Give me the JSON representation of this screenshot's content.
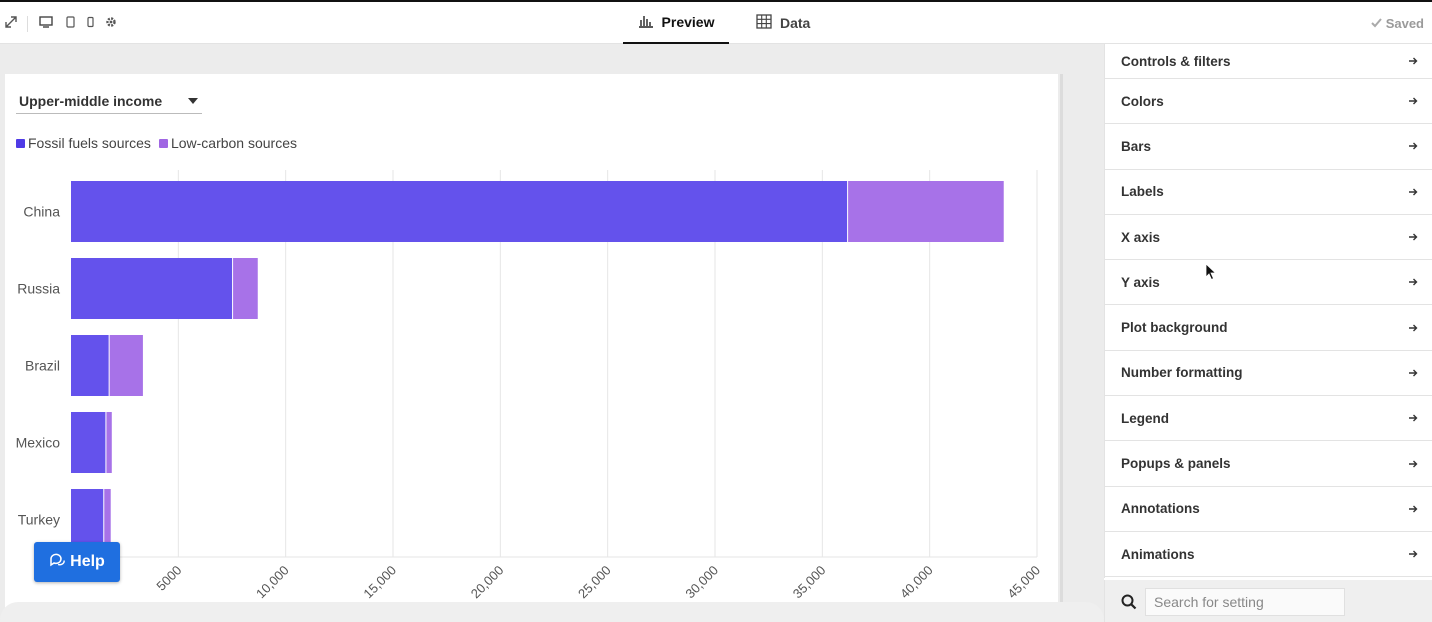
{
  "toolbar": {
    "tabs": [
      {
        "label": "Preview",
        "icon": "bar-chart-icon"
      },
      {
        "label": "Data",
        "icon": "table-grid-icon"
      }
    ],
    "saved_label": "Saved"
  },
  "filter": {
    "selected": "Upper-middle income"
  },
  "legend": [
    {
      "label": "Fossil fuels sources",
      "color": "#4f3be6"
    },
    {
      "label": "Low-carbon sources",
      "color": "#a066e3"
    }
  ],
  "help": {
    "label": "Help"
  },
  "settings": {
    "items": [
      {
        "label": "Controls & filters"
      },
      {
        "label": "Colors"
      },
      {
        "label": "Bars"
      },
      {
        "label": "Labels"
      },
      {
        "label": "X axis"
      },
      {
        "label": "Y axis"
      },
      {
        "label": "Plot background"
      },
      {
        "label": "Number formatting"
      },
      {
        "label": "Legend"
      },
      {
        "label": "Popups & panels"
      },
      {
        "label": "Annotations"
      },
      {
        "label": "Animations"
      }
    ],
    "search_placeholder": "Search for setting"
  },
  "chart_data": {
    "type": "bar",
    "orientation": "horizontal",
    "stacked": true,
    "categories": [
      "China",
      "Russia",
      "Brazil",
      "Mexico",
      "Turkey"
    ],
    "series": [
      {
        "name": "Fossil fuels sources",
        "color": "#6452ec",
        "values": [
          36200,
          7550,
          1800,
          1650,
          1550
        ]
      },
      {
        "name": "Low-carbon sources",
        "color": "#a772e8",
        "values": [
          7250,
          1150,
          1550,
          250,
          300
        ]
      }
    ],
    "xlim": [
      0,
      45000
    ],
    "xticks": [
      "5000",
      "10,000",
      "15,000",
      "20,000",
      "25,000",
      "30,000",
      "35,000",
      "40,000",
      "45,000"
    ],
    "xtick_values": [
      5000,
      10000,
      15000,
      20000,
      25000,
      30000,
      35000,
      40000,
      45000
    ],
    "grid": true
  }
}
